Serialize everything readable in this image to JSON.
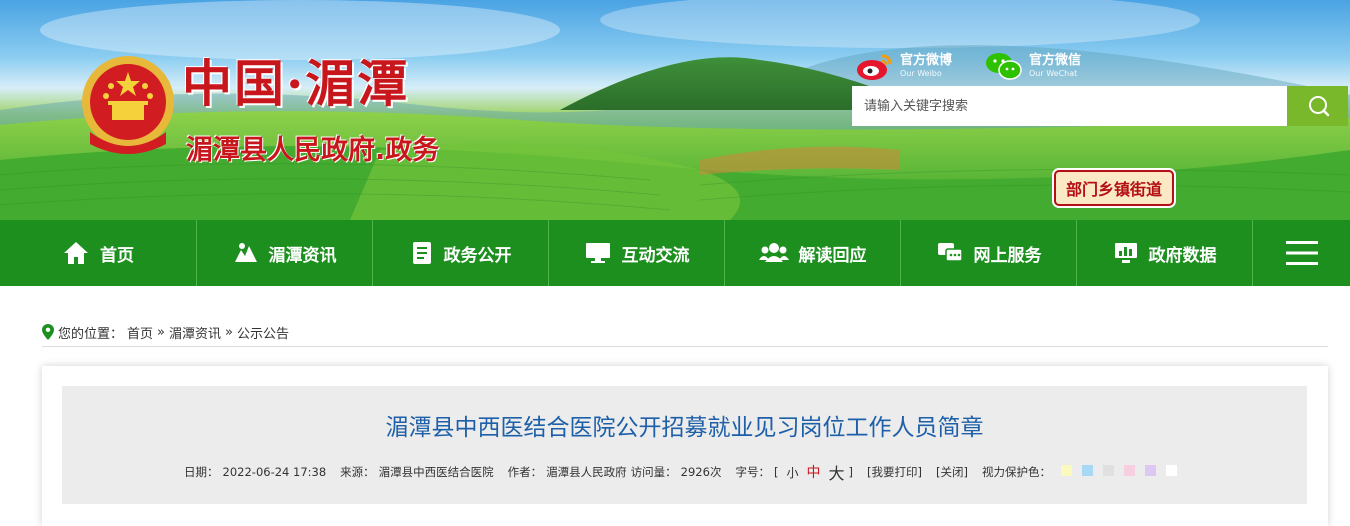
{
  "header": {
    "title_main": "中国·湄潭",
    "title_sub": "湄潭县人民政府.政务",
    "weibo": {
      "label": "官方微博",
      "sub": "Our Weibo"
    },
    "wechat": {
      "label": "官方微信",
      "sub": "Our WeChat"
    },
    "search": {
      "placeholder": "请输入关键字搜索"
    },
    "dept_button": "部门乡镇街道"
  },
  "nav": {
    "items": [
      {
        "label": "首页",
        "icon": "home-icon"
      },
      {
        "label": "湄潭资讯",
        "icon": "news-icon"
      },
      {
        "label": "政务公开",
        "icon": "document-icon"
      },
      {
        "label": "互动交流",
        "icon": "monitor-icon"
      },
      {
        "label": "解读回应",
        "icon": "people-icon"
      },
      {
        "label": "网上服务",
        "icon": "chat-icon"
      },
      {
        "label": "政府数据",
        "icon": "data-icon"
      }
    ],
    "menu_icon": "hamburger-icon"
  },
  "breadcrumb": {
    "prefix": "您的位置：",
    "items": [
      "首页",
      "湄潭资讯",
      "公示公告"
    ],
    "separator": "»"
  },
  "article": {
    "title": "湄潭县中西医结合医院公开招募就业见习岗位工作人员简章",
    "date_label": "日期：",
    "date": "2022-06-24 17:38",
    "source_label": "来源：",
    "source": "湄潭县中西医结合医院",
    "author_label": "作者：",
    "author": "湄潭县人民政府",
    "views_label": "访问量：",
    "views": "2926次",
    "fontsize_label": "字号：",
    "fontsize_small": "小",
    "fontsize_mid": "中",
    "fontsize_big": "大",
    "print": "[我要打印]",
    "close": "[关闭]",
    "eye_label": "视力保护色：",
    "eye_colors": [
      "#fafabe",
      "#a8d8f5",
      "#e0e0e0",
      "#f6d0e0",
      "#dcc8f0",
      "#ffffff"
    ]
  },
  "colors": {
    "nav_green": "#1d8f1f",
    "title_red": "#c8161d",
    "article_blue": "#1d5fa8",
    "search_green": "#78b82a"
  }
}
